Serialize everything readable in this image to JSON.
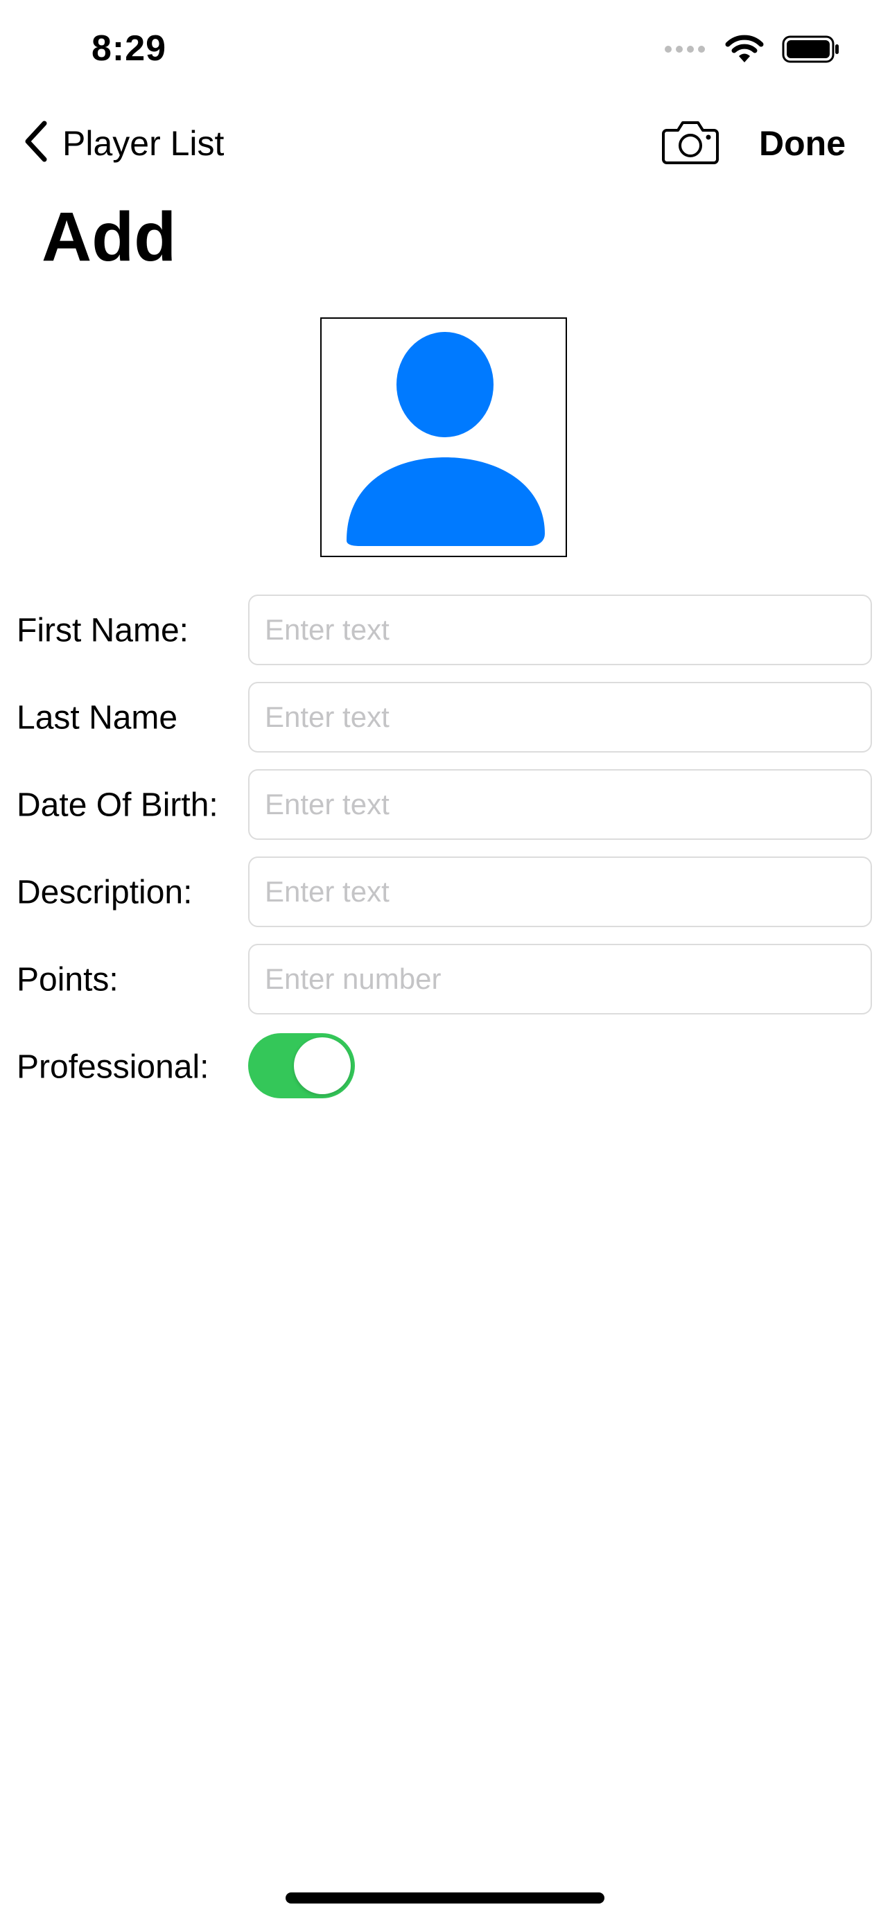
{
  "status_bar": {
    "time": "8:29",
    "icons": [
      "cellular-signal-icon",
      "wifi-icon",
      "battery-icon"
    ]
  },
  "nav": {
    "back_label": "Player List",
    "back_icon": "chevron-left-icon",
    "camera_icon": "camera-icon",
    "done_label": "Done"
  },
  "title": "Add",
  "avatar": {
    "icon": "person-icon",
    "color": "#007aff"
  },
  "form": {
    "rows": [
      {
        "label": "First Name:",
        "placeholder": "Enter text",
        "value": ""
      },
      {
        "label": "Last Name",
        "placeholder": "Enter text",
        "value": ""
      },
      {
        "label": "Date Of Birth:",
        "placeholder": "Enter text",
        "value": ""
      },
      {
        "label": "Description:",
        "placeholder": "Enter text",
        "value": ""
      },
      {
        "label": "Points:",
        "placeholder": "Enter number",
        "value": ""
      }
    ],
    "toggle": {
      "label": "Professional:",
      "on": true,
      "color": "#34c759"
    }
  }
}
